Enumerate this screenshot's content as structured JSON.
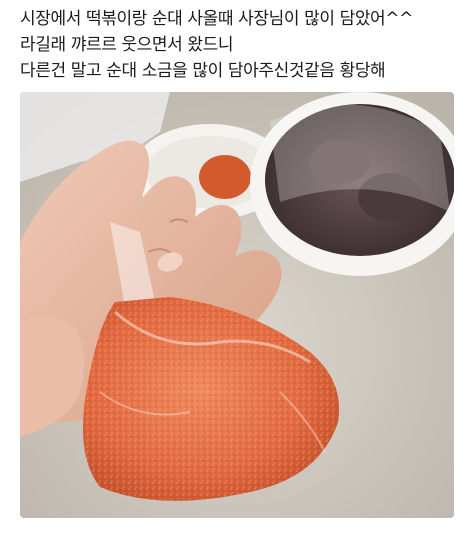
{
  "post": {
    "caption_lines": [
      "시장에서 떡볶이랑 순대 사올때 사장님이 많이 담았어^^",
      "라길래 꺄르르 웃으면서 왔드니",
      "다른건 말고 순대 소금을 많이 담아주신것같음 황당해"
    ]
  },
  "photo": {
    "subject": "hand holding plastic bag of seasoned salt",
    "colors": {
      "counter": "#d6d0c6",
      "salt": "#e8734a",
      "skin": "#e7b9a3",
      "bowl": "#f4f2ef",
      "sundae": "#4a3a3e"
    }
  }
}
